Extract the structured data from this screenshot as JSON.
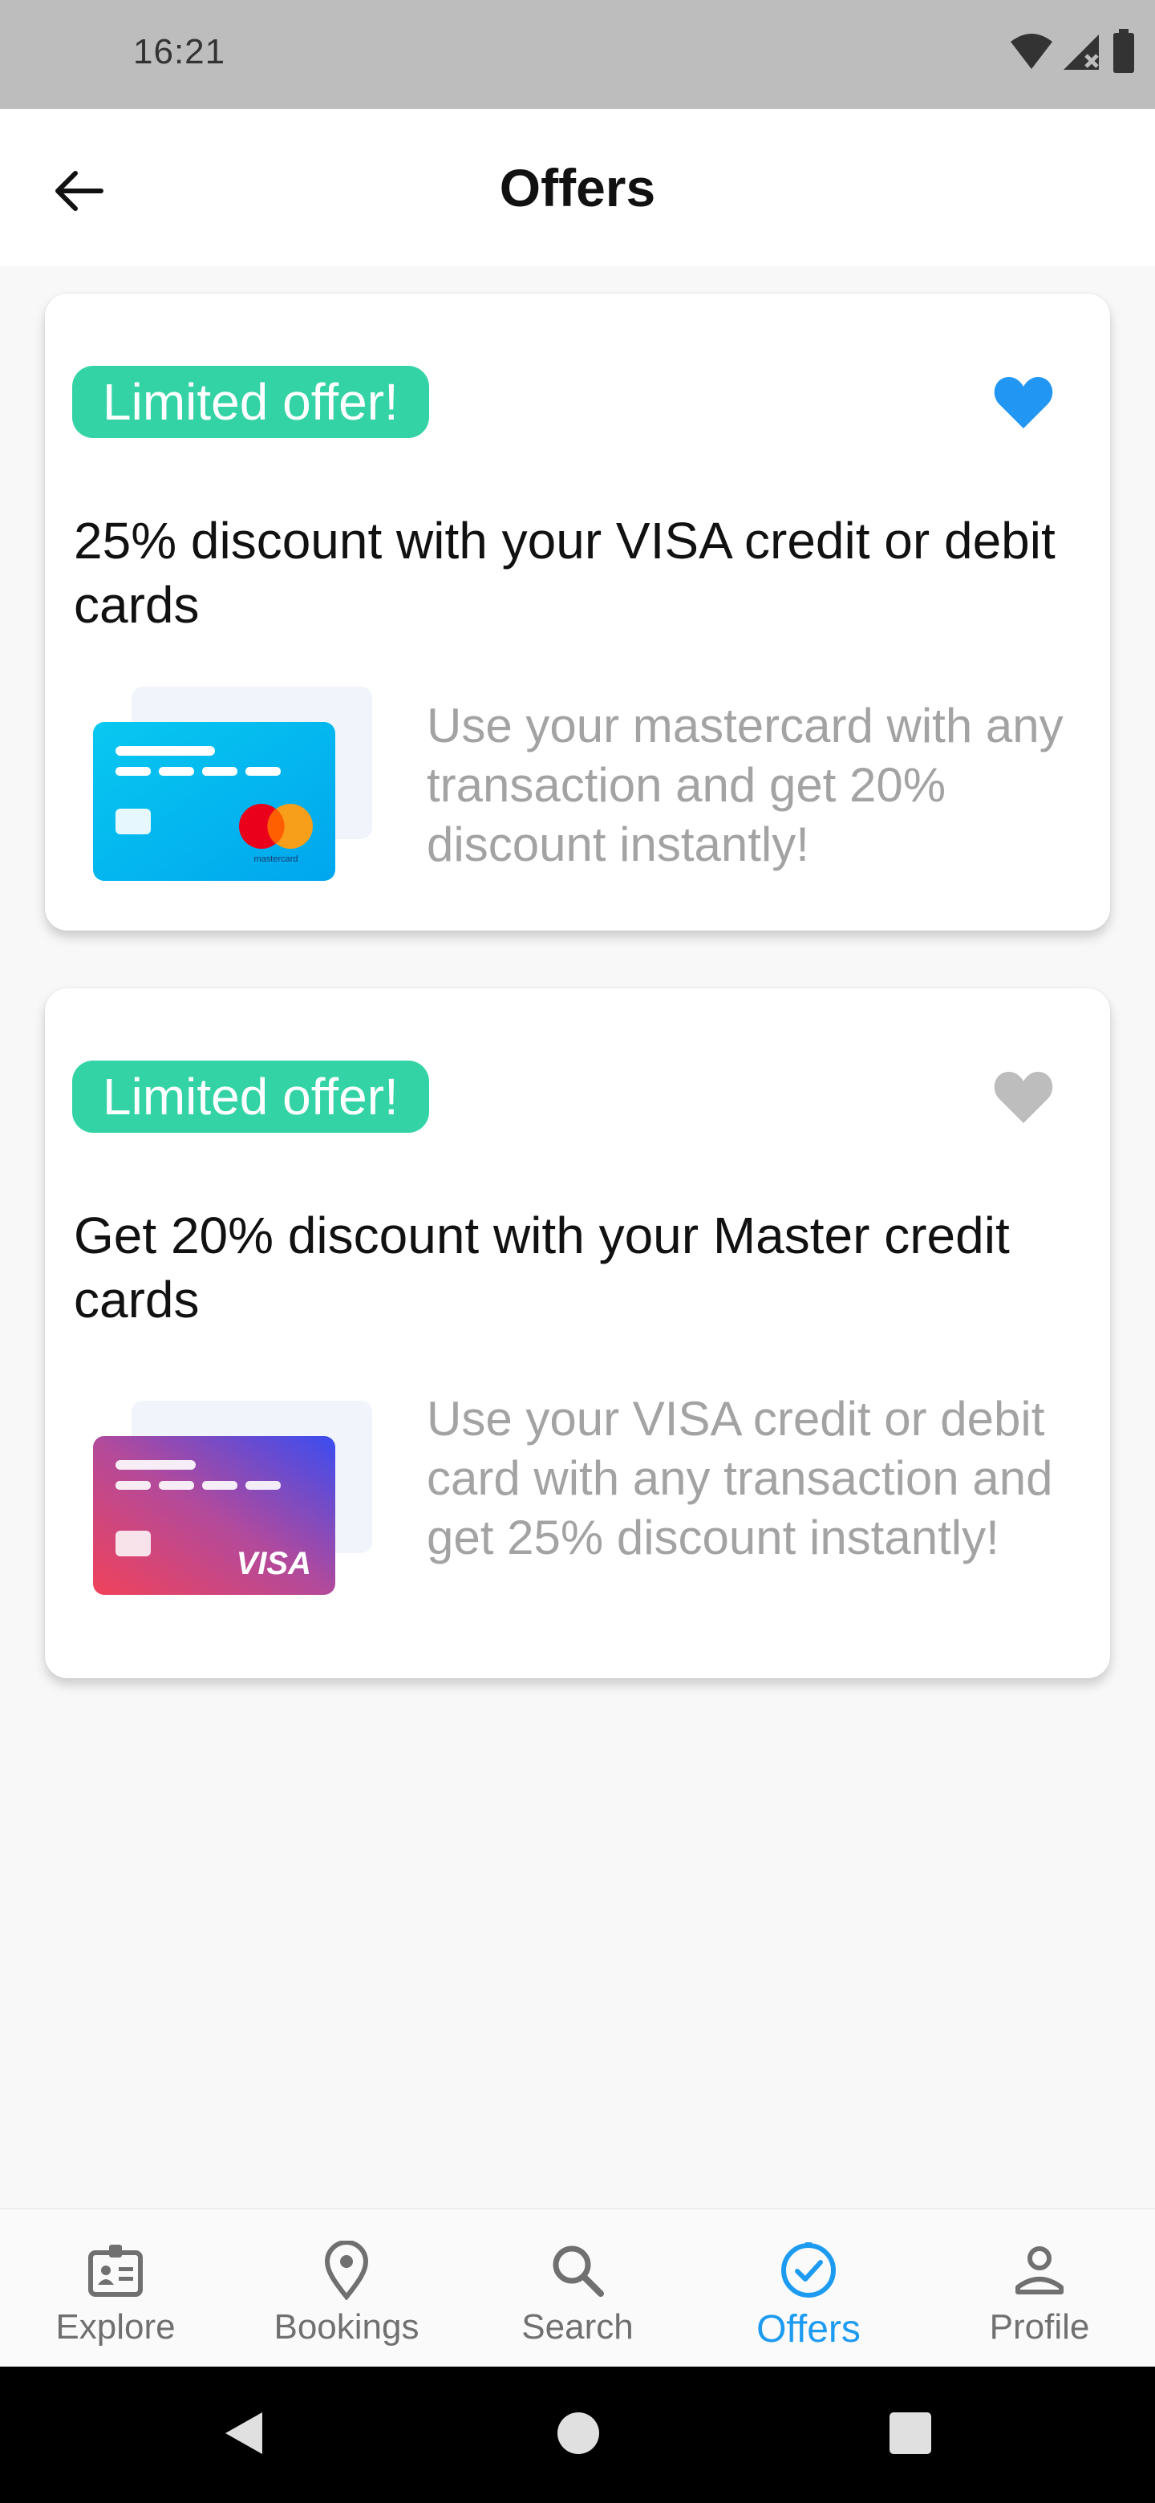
{
  "status_bar": {
    "time": "16:21"
  },
  "app_bar": {
    "title": "Offers"
  },
  "offers": [
    {
      "badge": "Limited offer!",
      "favorited": true,
      "title": "25% discount with your VISA credit or debit cards",
      "card_brand": "mastercard",
      "description": "Use your mastercard with any transaction and get 20% discount instantly!"
    },
    {
      "badge": "Limited offer!",
      "favorited": false,
      "title": "Get 20% discount with your Master credit cards",
      "card_brand": "VISA",
      "description": "Use your VISA credit or debit card with any transaction and get 25% discount instantly!"
    }
  ],
  "bottom_nav": [
    {
      "label": "Explore",
      "icon": "id-card-icon",
      "active": false
    },
    {
      "label": "Bookings",
      "icon": "location-pin-icon",
      "active": false
    },
    {
      "label": "Search",
      "icon": "search-icon",
      "active": false
    },
    {
      "label": "Offers",
      "icon": "check-circle-icon",
      "active": true
    },
    {
      "label": "Profile",
      "icon": "person-icon",
      "active": false
    }
  ],
  "colors": {
    "accent": "#1d9bf0",
    "badge": "#33d3a5",
    "favorite_active": "#2196f3",
    "favorite_inactive": "#bdbdbd"
  }
}
